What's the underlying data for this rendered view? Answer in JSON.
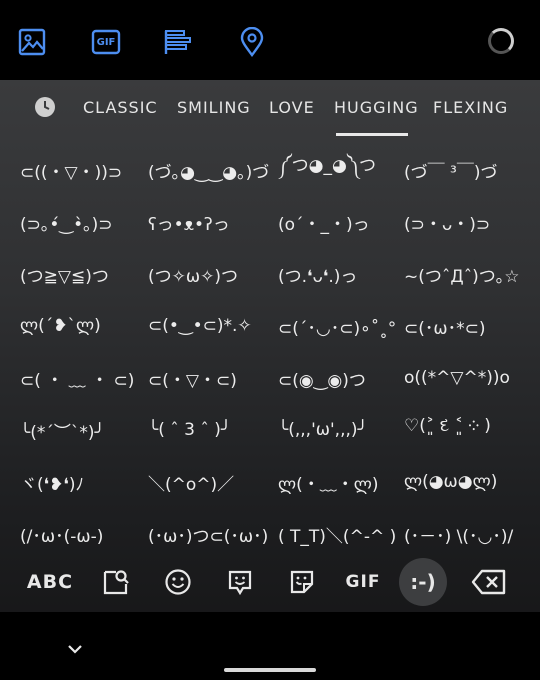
{
  "toolbar": {
    "icons": [
      "image-icon",
      "gif-icon",
      "text-align-icon",
      "location-icon"
    ],
    "gif_label": "GIF",
    "accent": "#4d8ef0"
  },
  "tabs": {
    "items": [
      "CLASSIC",
      "SMILING",
      "LOVE",
      "HUGGING",
      "FLEXING"
    ],
    "selected": "HUGGING"
  },
  "emoticons": [
    [
      "⊂((・▽・))⊃",
      "(づ｡◕‿‿◕｡)づ",
      "༼つ◕_◕༽つ",
      "(づ￣ ³￣)づ"
    ],
    [
      "(⊃｡•́‿•̀｡)⊃",
      "ʕっ•ᴥ•ʔっ",
      "(o´・_・)っ",
      "(⊃・ᴗ・)⊃"
    ],
    [
      "(つ≧▽≦)つ",
      "(つ✧ω✧)つ",
      "(つ.❛ᴗ❛.)っ",
      "~(つˆДˆ)つ｡☆"
    ],
    [
      "ლ(´❥`ლ)",
      "⊂(•‿•⊂)*.✧",
      "⊂(´･◡･⊂)∘˚˳°",
      "⊂(･ω･*⊂)"
    ],
    [
      "⊂( ・ ﹏ ・ ⊂)",
      "⊂(・▽・⊂)",
      "⊂(◉‿◉)つ",
      "o((*^▽^*))o"
    ],
    [
      "╰(*´︶`*)╯",
      "╰( ˆ 3 ˆ )╯",
      "╰(,,,'ω',,,)╯",
      "♡(˃͈ દ ˂͈ ༶ )"
    ],
    [
      "ヾ(❛❥❛)ﾉ",
      "＼(^o^)／",
      "ლ(・﹏・ლ)",
      "ლ(◕ω◕ლ)"
    ],
    [
      "(/･ω･(-ω-)",
      "(･ω･)つ⊂(･ω･)",
      "( T_T)＼(^-^ )",
      "(･－･) \\(･◡･)/"
    ]
  ],
  "bottom_bar": {
    "abc_label": "ABC",
    "gif_label": "GIF",
    "emoticon_label": ":-)",
    "items": [
      "keyboard-abc",
      "sticker-search-icon",
      "emoji-icon",
      "emoji-sticker-icon",
      "sticker-icon",
      "gif",
      "emoticon",
      "backspace-icon"
    ]
  }
}
